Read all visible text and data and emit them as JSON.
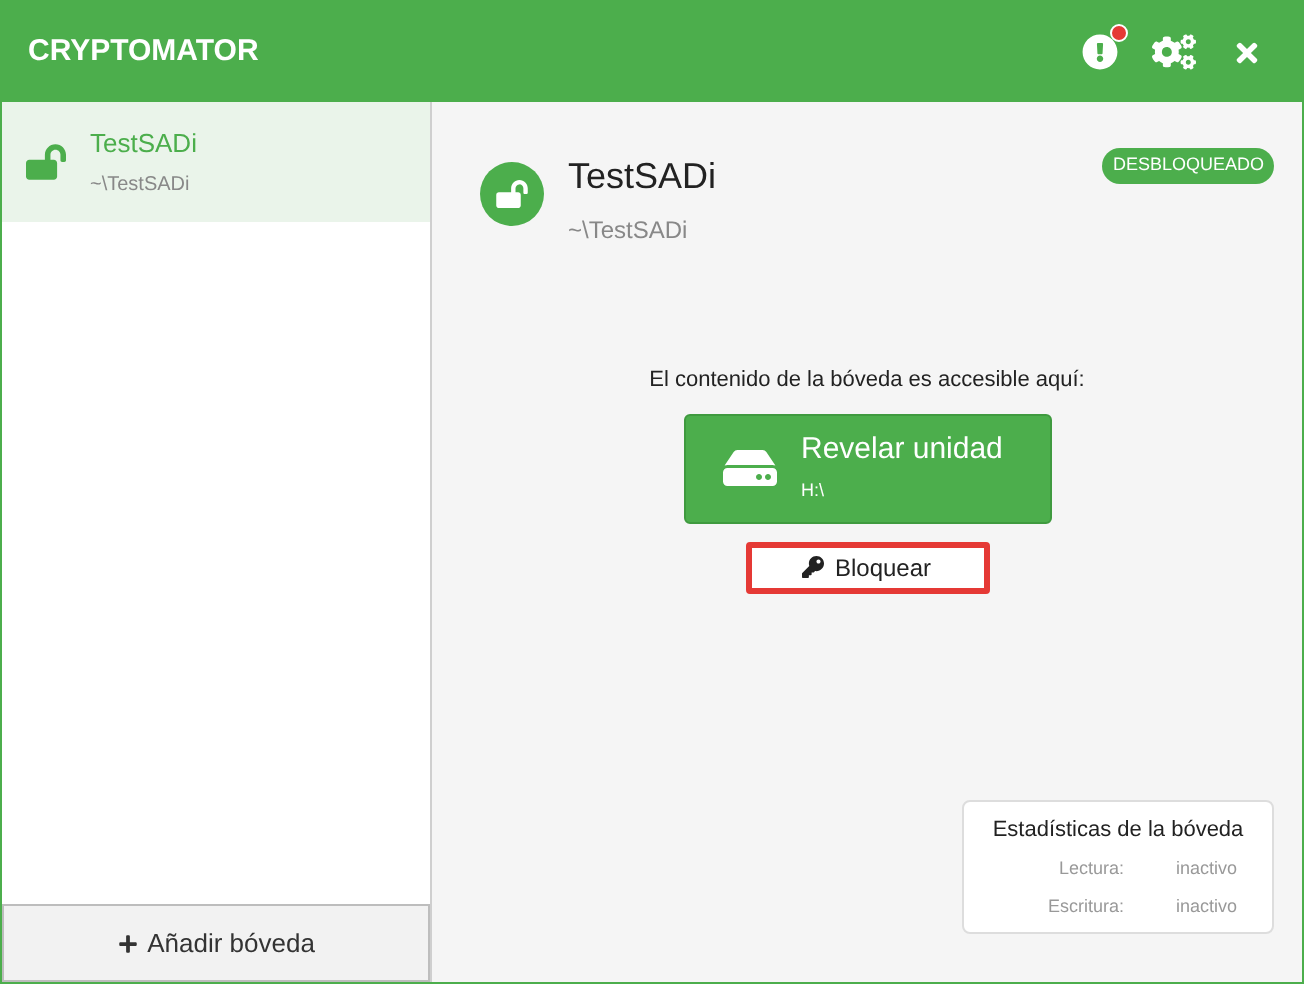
{
  "window": {
    "title": "CRYPTOMATOR",
    "has_notification": true
  },
  "sidebar": {
    "vaults": [
      {
        "name": "TestSADi",
        "path": "~\\TestSADi",
        "selected": true,
        "unlocked": true
      }
    ],
    "add_button": "Añadir bóveda"
  },
  "vault": {
    "name": "TestSADi",
    "path": "~\\TestSADi",
    "unlocked": true,
    "badge": "DESBLOQUEADO",
    "access_label": "El contenido de la bóveda es accesible aquí:",
    "reveal_button": {
      "label": "Revelar unidad",
      "drive": "H:\\"
    },
    "lock_button": {
      "label": "Bloquear",
      "highlighted": true
    }
  },
  "stats": {
    "title": "Estadísticas de la bóveda",
    "rows": [
      {
        "label": "Lectura:",
        "value": "inactivo"
      },
      {
        "label": "Escritura:",
        "value": "inactivo"
      }
    ]
  }
}
